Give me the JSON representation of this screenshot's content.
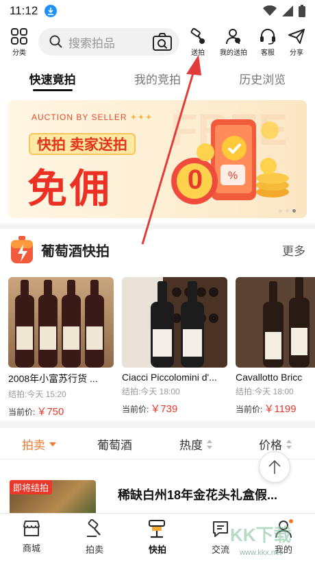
{
  "status_bar": {
    "time": "11:12"
  },
  "top_bar": {
    "category_label": "分类",
    "search_placeholder": "搜索拍品",
    "actions": [
      {
        "label": "送拍",
        "icon": "gavel-icon"
      },
      {
        "label": "我的送拍",
        "icon": "user-gavel-icon"
      },
      {
        "label": "客服",
        "icon": "headset-icon"
      },
      {
        "label": "分享",
        "icon": "share-icon"
      }
    ]
  },
  "tabs": [
    {
      "label": "快速竟拍",
      "active": true
    },
    {
      "label": "我的竞拍",
      "active": false
    },
    {
      "label": "历史浏览",
      "active": false
    }
  ],
  "banner": {
    "small_text": "AUCTION BY SELLER",
    "tagline": "快拍 卖家送拍",
    "headline": "免佣",
    "bg_text": "FREE",
    "coin_text": "0"
  },
  "wine_section": {
    "title": "葡萄酒快拍",
    "more_label": "更多",
    "items": [
      {
        "name": "2008年小富苏行货 ...",
        "end": "结拍:今天 15:20",
        "price_label": "当前价:",
        "price": "￥750"
      },
      {
        "name": "Ciacci Piccolomini d'...",
        "end": "结拍:今天 18:00",
        "price_label": "当前价:",
        "price": "￥739"
      },
      {
        "name": "Cavallotto Bricc",
        "end": "结拍:今天 18:00",
        "price_label": "当前价:",
        "price": "￥1199"
      }
    ]
  },
  "filters": [
    {
      "label": "拍卖",
      "active": true
    },
    {
      "label": "葡萄酒",
      "active": false
    },
    {
      "label": "热度",
      "active": false
    },
    {
      "label": "价格",
      "active": false
    }
  ],
  "product": {
    "badge": "即将结拍",
    "title": "稀缺白州18年金花头礼盒假..."
  },
  "bottom_nav": [
    {
      "label": "商城",
      "icon": "shop-icon",
      "active": false
    },
    {
      "label": "拍卖",
      "icon": "hammer-icon",
      "active": false
    },
    {
      "label": "快拍",
      "icon": "quick-auction-icon",
      "active": true
    },
    {
      "label": "交流",
      "icon": "chat-icon",
      "active": false
    },
    {
      "label": "我的",
      "icon": "profile-icon",
      "active": false
    }
  ],
  "watermark": {
    "text": "KK下载",
    "url": "www.kkx.net"
  },
  "colors": {
    "accent": "#e8392c",
    "filter_active": "#f07a2d",
    "arrow": "#e23b3b"
  }
}
